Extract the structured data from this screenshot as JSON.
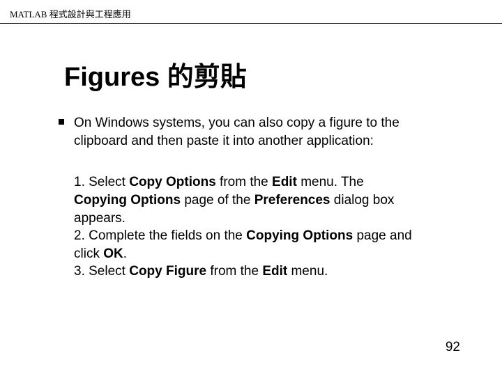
{
  "header": "MATLAB 程式設計與工程應用",
  "title": "Figures 的剪貼",
  "intro": "On Windows systems, you can also copy a figure to the clipboard and then paste it into another application:",
  "step1_prefix": "1.  Select ",
  "step1_b1": "Copy Options",
  "step1_mid1": " from the ",
  "step1_b2": "Edit",
  "step1_mid2": " menu. The ",
  "step1_b3": "Copying Options",
  "step1_mid3": " page of the ",
  "step1_b4": "Preferences",
  "step1_suffix": " dialog box appears.",
  "step2_prefix": "2.  Complete the fields on the ",
  "step2_b1": "Copying Options",
  "step2_mid1": " page and click ",
  "step2_b2": "OK",
  "step2_suffix": ".",
  "step3_prefix": "3.  Select ",
  "step3_b1": "Copy Figure",
  "step3_mid1": " from the ",
  "step3_b2": "Edit",
  "step3_suffix": " menu.",
  "pageNumber": "92"
}
